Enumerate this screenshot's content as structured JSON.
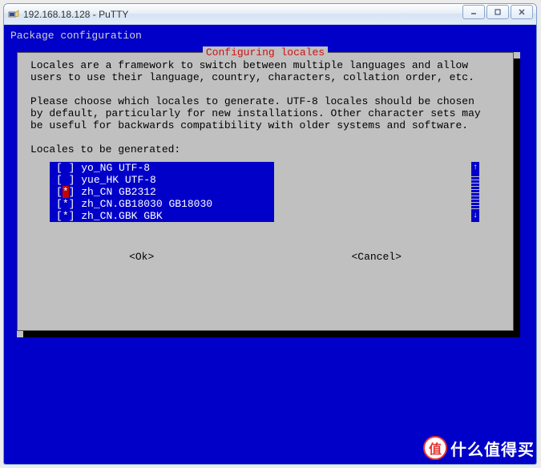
{
  "window": {
    "title": "192.168.18.128 - PuTTY"
  },
  "terminal": {
    "header_text": "Package configuration"
  },
  "dialog": {
    "title": "Configuring locales",
    "title_dash_left": "────────┤ ",
    "title_dash_right": " ├────────",
    "para1": "Locales are a framework to switch between multiple languages and allow\nusers to use their language, country, characters, collation order, etc.",
    "para2": "Please choose which locales to generate. UTF-8 locales should be chosen\nby default, particularly for new installations. Other character sets may\nbe useful for backwards compatibility with older systems and software.",
    "prompt": "Locales to be generated:",
    "items": [
      {
        "checked": false,
        "label": "yo_NG UTF-8",
        "cursor": false
      },
      {
        "checked": false,
        "label": "yue_HK UTF-8",
        "cursor": false
      },
      {
        "checked": true,
        "label": "zh_CN GB2312",
        "cursor": true
      },
      {
        "checked": true,
        "label": "zh_CN.GB18030 GB18030",
        "cursor": false
      },
      {
        "checked": true,
        "label": "zh_CN.GBK GBK",
        "cursor": false
      }
    ],
    "ok_label": "<Ok>",
    "cancel_label": "<Cancel>",
    "scroll_up": "↑",
    "scroll_down": "↓"
  },
  "watermark": {
    "badge": "值",
    "text": "什么值得买"
  }
}
